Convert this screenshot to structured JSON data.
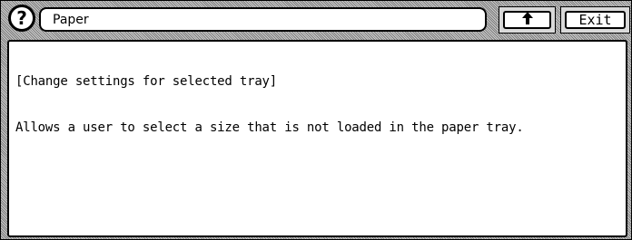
{
  "header": {
    "title": "Paper",
    "help_icon": "question-circle-icon",
    "back_icon": "return-arrow-icon",
    "exit_label": "Exit"
  },
  "body": {
    "heading": "[Change settings for selected tray]",
    "description": "Allows a user to select a size that is not loaded in the paper tray."
  },
  "colors": {
    "background_pattern": "#bdbdbd",
    "panel": "#ffffff",
    "border": "#000000"
  }
}
